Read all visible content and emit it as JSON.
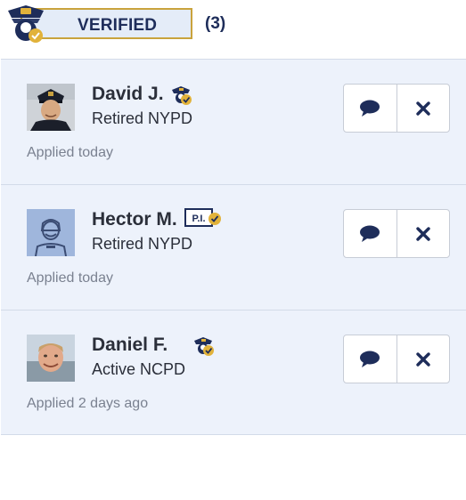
{
  "header": {
    "verified_label": "VERIFIED",
    "count": "(3)"
  },
  "colors": {
    "navy": "#1e2d5a",
    "gold": "#e1b23a",
    "card_bg": "#edf2fb",
    "muted": "#7a8190"
  },
  "applicants": [
    {
      "name": "David J.",
      "subtitle": "Retired NYPD",
      "applied": "Applied today",
      "badge": "police-verified-icon",
      "avatar": "photo-officer"
    },
    {
      "name": "Hector M.",
      "subtitle": "Retired NYPD",
      "applied": "Applied today",
      "badge": "pi-verified-icon",
      "badge_text": "P.I.",
      "avatar": "placeholder-officer"
    },
    {
      "name": "Daniel F.",
      "subtitle": "Active NCPD",
      "applied": "Applied 2 days ago",
      "badge": "police-verified-icon",
      "avatar": "photo-man"
    }
  ],
  "actions": {
    "message_icon": "chat-bubble-icon",
    "dismiss_icon": "close-icon"
  }
}
